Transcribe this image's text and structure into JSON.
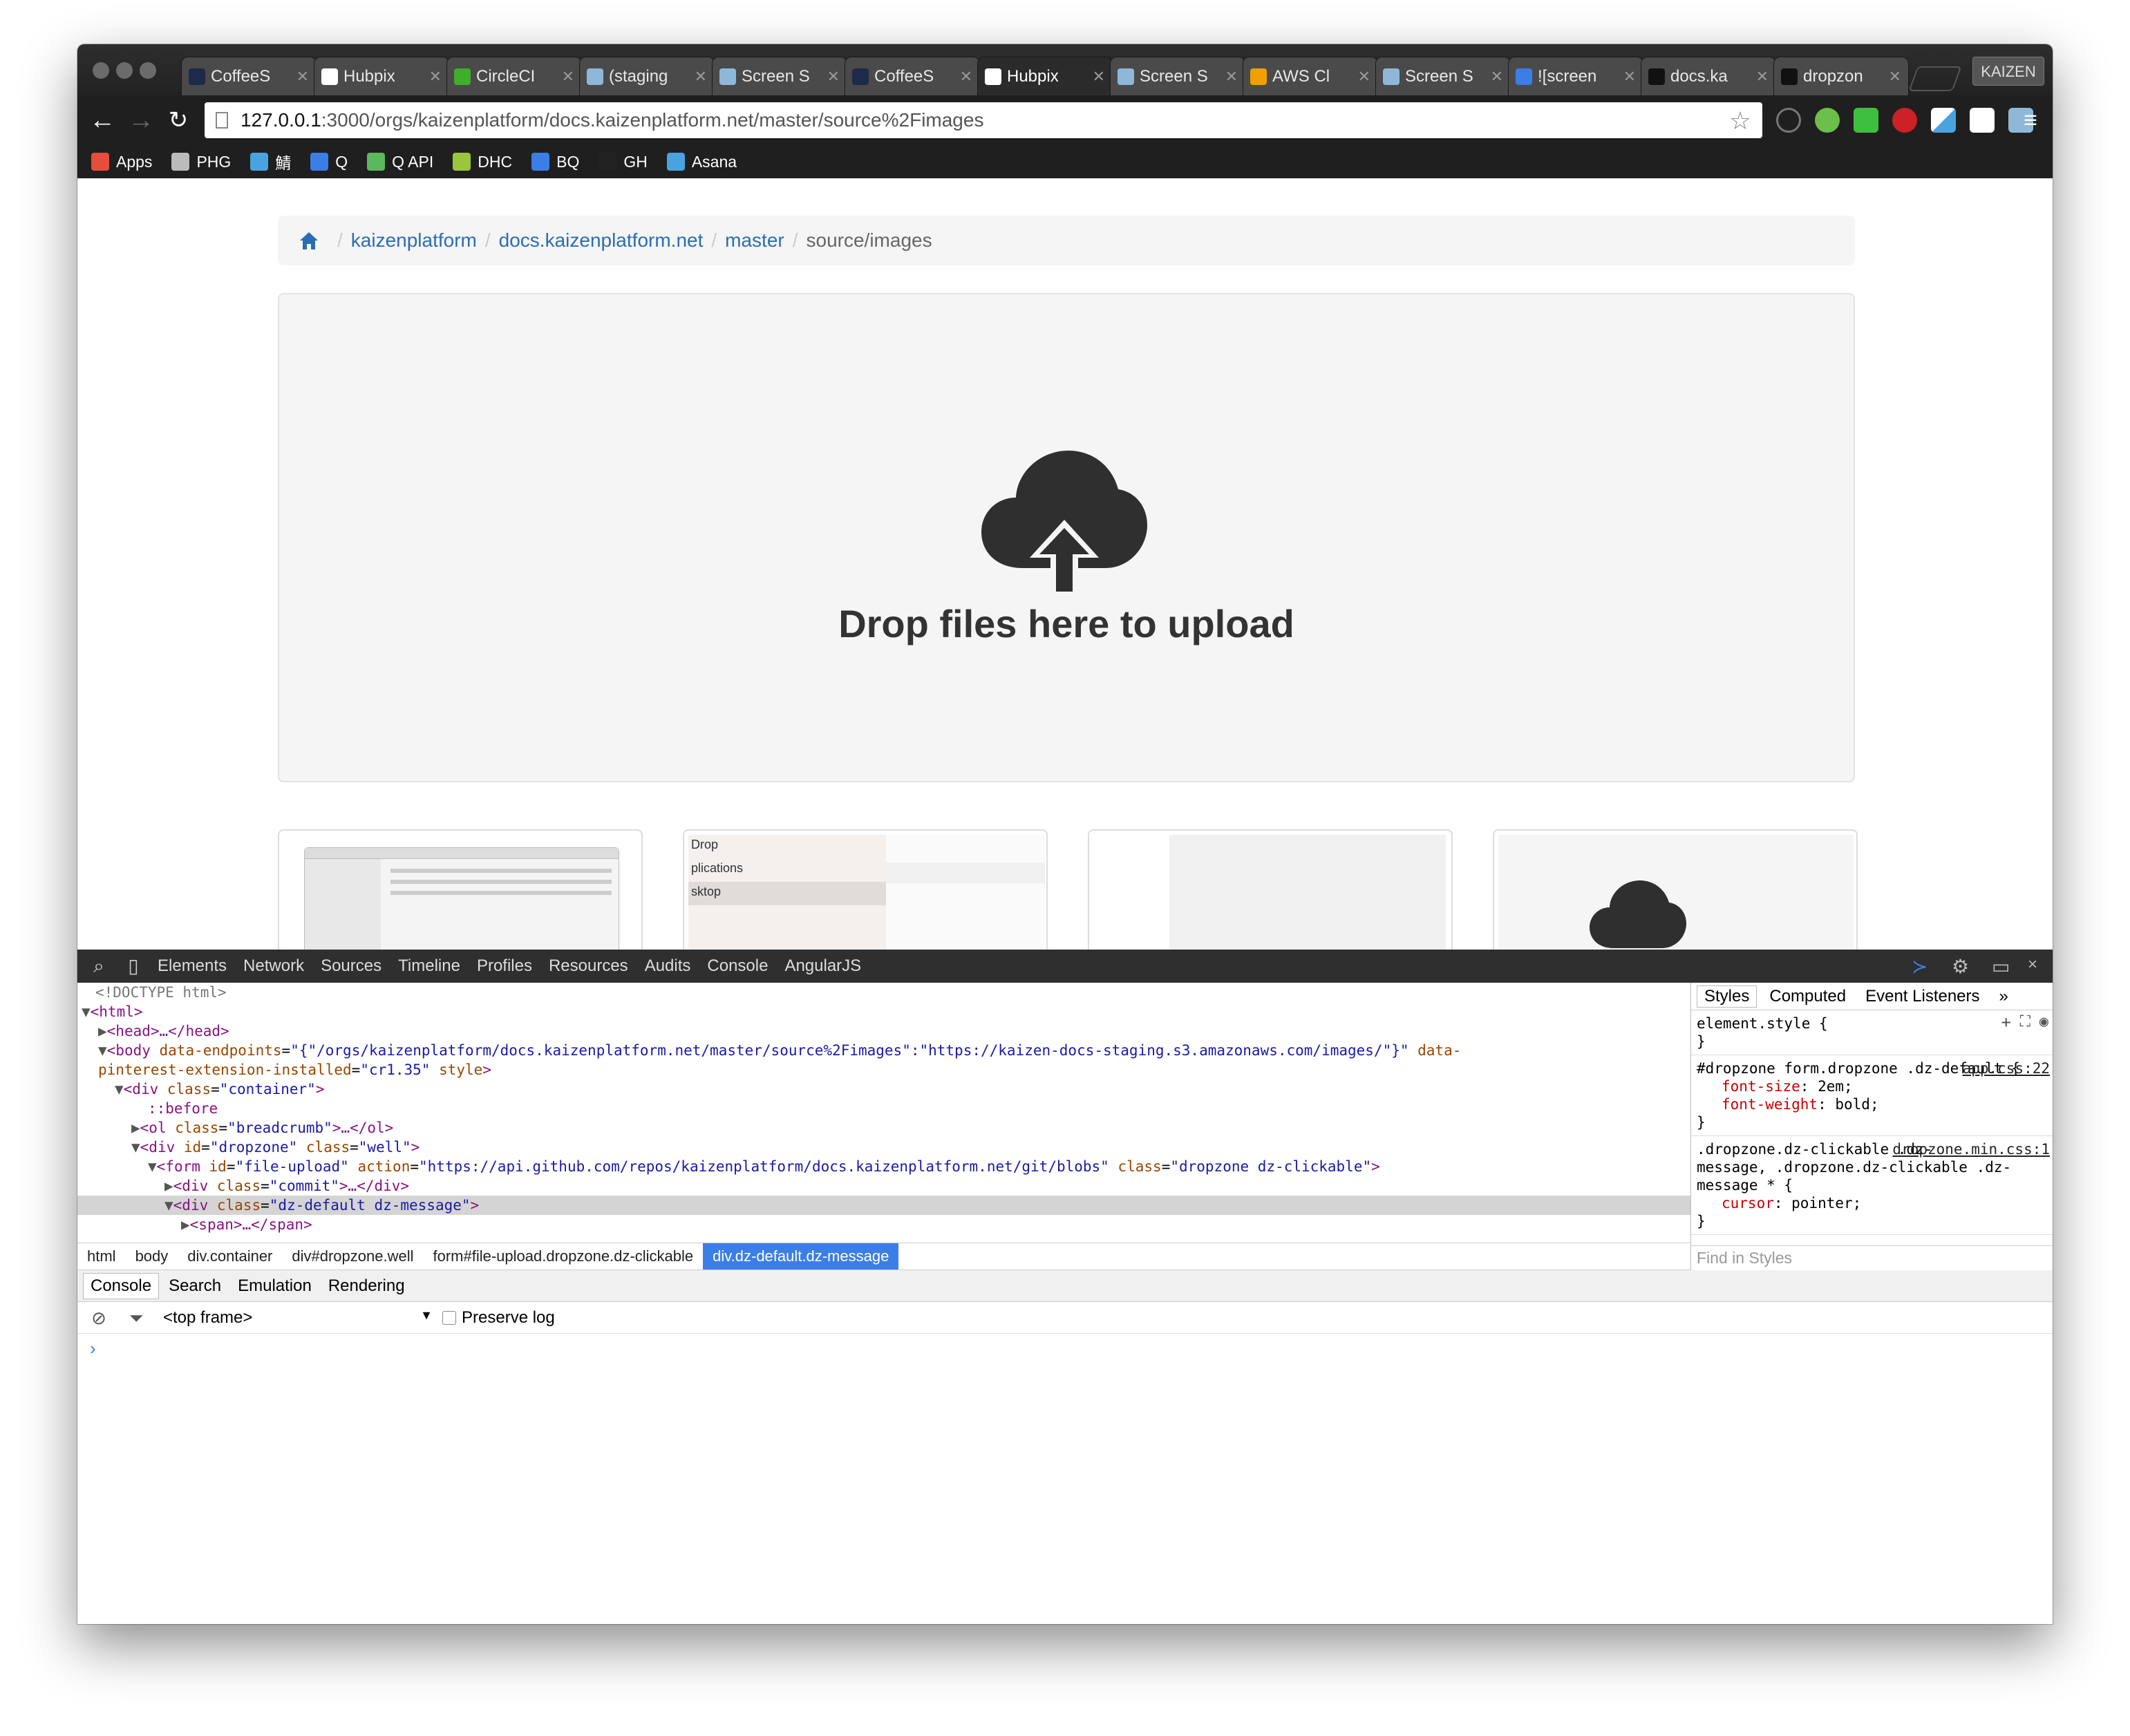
{
  "browser": {
    "tabs": [
      {
        "label": "CoffeeS",
        "favicon_color": "#1e2a4a"
      },
      {
        "label": "Hubpix",
        "favicon_color": "#ffffff"
      },
      {
        "label": "CircleCI",
        "favicon_color": "#3fae2a"
      },
      {
        "label": "(staging",
        "favicon_color": "#8fb8d8"
      },
      {
        "label": "Screen S",
        "favicon_color": "#8fb8d8"
      },
      {
        "label": "CoffeeS",
        "favicon_color": "#1e2a4a"
      },
      {
        "label": "Hubpix",
        "favicon_color": "#ffffff"
      },
      {
        "label": "Screen S",
        "favicon_color": "#8fb8d8"
      },
      {
        "label": "AWS Cl",
        "favicon_color": "#f0a000"
      },
      {
        "label": "Screen S",
        "favicon_color": "#8fb8d8"
      },
      {
        "label": "![screen",
        "favicon_color": "#3b7ee6"
      },
      {
        "label": "docs.ka",
        "favicon_color": "#111111"
      },
      {
        "label": "dropzon",
        "favicon_color": "#111111"
      }
    ],
    "active_tab_index": 6,
    "profile_label": "KAIZEN",
    "url_host": "127.0.0.1",
    "url_rest": ":3000/orgs/kaizenplatform/docs.kaizenplatform.net/master/source%2Fimages",
    "bookmarks": [
      {
        "label": "Apps",
        "color": "#e74c3c"
      },
      {
        "label": "PHG",
        "color": "#bbbbbb"
      },
      {
        "label": "鯖",
        "color": "#4aa3df"
      },
      {
        "label": "Q",
        "color": "#3b7ee6"
      },
      {
        "label": "Q API",
        "color": "#5cb85c"
      },
      {
        "label": "DHC",
        "color": "#9bc53d"
      },
      {
        "label": "BQ",
        "color": "#3b7ee6"
      },
      {
        "label": "GH",
        "color": "#222222"
      },
      {
        "label": "Asana",
        "color": "#4aa3df"
      }
    ]
  },
  "page": {
    "breadcrumb": {
      "links": [
        "kaizenplatform",
        "docs.kaizenplatform.net",
        "master"
      ],
      "active": "source/images",
      "separator": "/"
    },
    "dropzone_message": "Drop files here to upload",
    "thumb2_lines": [
      "Drop",
      "plications",
      "sktop"
    ]
  },
  "devtools": {
    "tabs": [
      "Elements",
      "Network",
      "Sources",
      "Timeline",
      "Profiles",
      "Resources",
      "Audits",
      "Console",
      "AngularJS"
    ],
    "dom": {
      "l1": "<!DOCTYPE html>",
      "l2_tag": "<html>",
      "l3": "<head>…</head>",
      "l4_open": "<body ",
      "l4_a1n": "data-endpoints",
      "l4_a1v": "\"{\"/orgs/kaizenplatform/docs.kaizenplatform.net/master/source%2Fimages\":\"https://kaizen-docs-staging.s3.amazonaws.com/images/\"}\"",
      "l4_a2n": " data-",
      "l5_a2n": "pinterest-extension-installed",
      "l5_a2v": "\"cr1.35\"",
      "l5_a3n": " style",
      "l5_close": ">",
      "l6_open": "<div ",
      "l6_an": "class",
      "l6_av": "\"container\"",
      "l6_close": ">",
      "l7": "::before",
      "l8_open": "<ol ",
      "l8_an": "class",
      "l8_av": "\"breadcrumb\"",
      "l8_close": ">…</ol>",
      "l9_open": "<div ",
      "l9_a1n": "id",
      "l9_a1v": "\"dropzone\"",
      "l9_a2n": " class",
      "l9_a2v": "\"well\"",
      "l9_close": ">",
      "l10_open": "<form ",
      "l10_a1n": "id",
      "l10_a1v": "\"file-upload\"",
      "l10_a2n": " action",
      "l10_a2v": "\"https://api.github.com/repos/kaizenplatform/docs.kaizenplatform.net/git/blobs\"",
      "l10_a3n": " class",
      "l10_a3v": "\"dropzone dz-clickable\"",
      "l10_close": ">",
      "l11_open": "<div ",
      "l11_an": "class",
      "l11_av": "\"commit\"",
      "l11_close": ">…</div>",
      "l12_open": "<div ",
      "l12_an": "class",
      "l12_av": "\"dz-default dz-message\"",
      "l12_close": ">",
      "l13": "<span>…</span>"
    },
    "crumbs": [
      "html",
      "body",
      "div.container",
      "div#dropzone.well",
      "form#file-upload.dropzone.dz-clickable",
      "div.dz-default.dz-message"
    ],
    "styles": {
      "tabs": [
        "Styles",
        "Computed",
        "Event Listeners"
      ],
      "more": "»",
      "rules": [
        {
          "selector": "element.style {",
          "source": "",
          "props": [],
          "close": "}"
        },
        {
          "selector": "#dropzone form.dropzone .dz-default {",
          "source": "app.css:22",
          "props": [
            {
              "name": "font-size",
              "value": "2em;"
            },
            {
              "name": "font-weight",
              "value": "bold;"
            }
          ],
          "close": "}"
        },
        {
          "selector": ".dropzone.dz-clickable .dz-",
          "selector2": "message, .dropzone.dz-clickable .dz-message * {",
          "source": "dropzone.min.css:1",
          "props": [
            {
              "name": "cursor",
              "value": "pointer;"
            }
          ],
          "close": "}"
        }
      ],
      "find_placeholder": "Find in Styles"
    },
    "drawer_tabs": [
      "Console",
      "Search",
      "Emulation",
      "Rendering"
    ],
    "console": {
      "frame": "<top frame>",
      "frame_arrow": "▼",
      "preserve_log": "Preserve log",
      "prompt": "›"
    }
  }
}
